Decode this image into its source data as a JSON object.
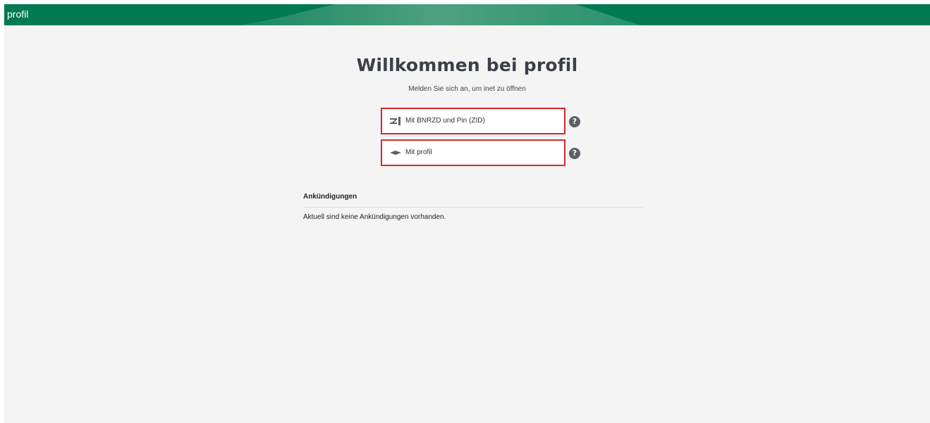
{
  "header": {
    "brand": "profil",
    "color": "#017951"
  },
  "main": {
    "title": "Willkommen bei profil",
    "subtitle": "Melden Sie sich an, um inet zu öffnen",
    "login_options": [
      {
        "label": "Mit BNRZD und Pin (ZID)",
        "icon": "zid-card-icon",
        "help_icon": "question-mark-icon"
      },
      {
        "label": "Mit profil",
        "icon": "profil-diamond-icon",
        "help_icon": "question-mark-icon"
      }
    ],
    "highlight_color": "#d9262c"
  },
  "announcements": {
    "heading": "Ankündigungen",
    "empty_text": "Aktuell sind keine Ankündigungen vorhanden."
  }
}
